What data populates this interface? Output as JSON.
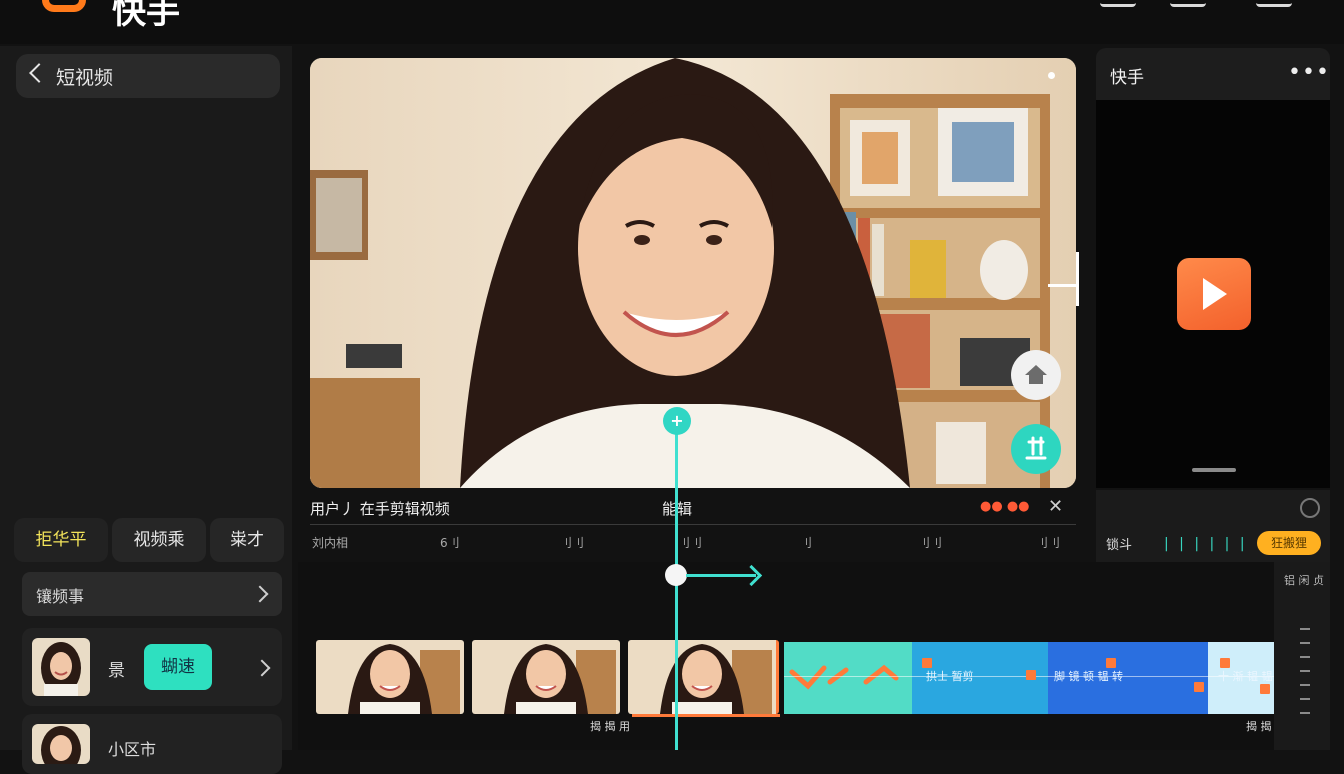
{
  "app": {
    "logo_text": "快手"
  },
  "left_panel": {
    "back_label": "短视频",
    "tabs": [
      "拒华平",
      "视频乘",
      "粜才"
    ],
    "menu_label": "镶频事",
    "clip_label": "景",
    "speed_button": "蝴速",
    "clip2_label": "小区市"
  },
  "preview": {
    "info_left": "用户丿  在手剪辑视频",
    "info_mid": "能辑",
    "info_dots": "●● ●●",
    "ruler_labels": [
      "刘内相",
      "6刂",
      "刂刂",
      "刂刂",
      "刂",
      "刂刂",
      "刂刂"
    ]
  },
  "right_panel": {
    "title": "快手",
    "bar_label": "锁斗",
    "pill_label": "狂搬狸",
    "ticks": "| | | | | |"
  },
  "timeline": {
    "segment_labels": [
      "拱士 暂剪",
      "脚 镜 顿 韫 转",
      "十 渐 韫 韫"
    ],
    "captions": [
      "揭 揭 用",
      "揭 揭 用"
    ],
    "side_label": "铝 闲 贞"
  },
  "colors": {
    "accent": "#40e0d0",
    "brand": "#ff7a1a",
    "play": "#f3612c"
  }
}
